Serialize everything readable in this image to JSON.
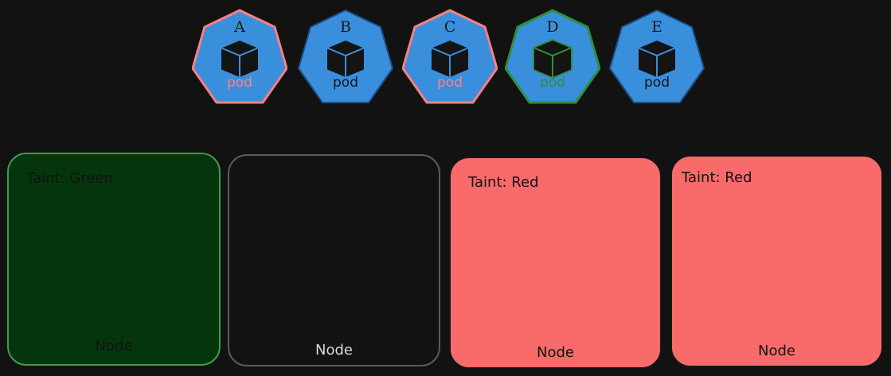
{
  "colors": {
    "background": "#121212",
    "pod_fill": "#3a8fdd",
    "pink": "#ff8080",
    "green": "#2f8f3a",
    "dark_stroke": "#1c4f86",
    "cube": "#141414",
    "node_green_fill": "#05350d",
    "node_green_stroke": "#3f9a49",
    "node_red_fill": "#f96b6b",
    "node_gray_stroke": "#5a5a5a"
  },
  "pods": [
    {
      "letter": "A",
      "label": "pod",
      "accent": "pink"
    },
    {
      "letter": "B",
      "label": "pod",
      "accent": "none"
    },
    {
      "letter": "C",
      "label": "pod",
      "accent": "pink"
    },
    {
      "letter": "D",
      "label": "pod",
      "accent": "green"
    },
    {
      "letter": "E",
      "label": "pod",
      "accent": "none"
    }
  ],
  "nodes": [
    {
      "taint": "Taint: Green",
      "label": "Node",
      "style": "green"
    },
    {
      "taint": "",
      "label": "Node",
      "style": "plain"
    },
    {
      "taint": "Taint: Red",
      "label": "Node",
      "style": "red"
    },
    {
      "taint": "Taint: Red",
      "label": "Node",
      "style": "red"
    }
  ]
}
